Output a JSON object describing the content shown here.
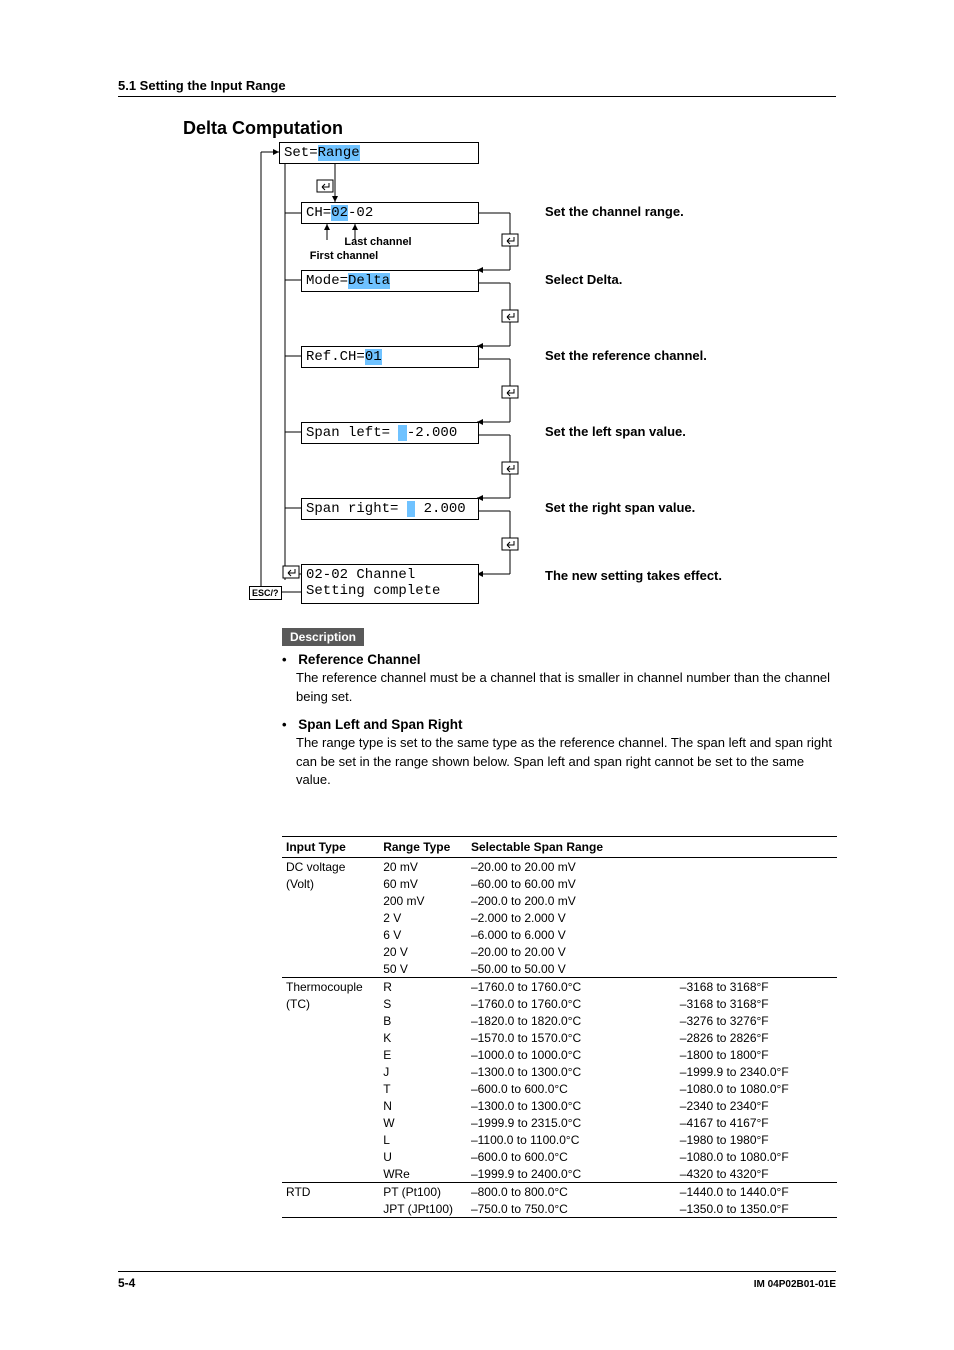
{
  "header": {
    "section": "5.1  Setting the Input Range"
  },
  "title": "Delta Computation",
  "flow": {
    "set": {
      "prefix": "Set=",
      "value": "Range"
    },
    "ch": {
      "prefix": "CH=",
      "v1": "02",
      "dash": "-02"
    },
    "ch_ann": {
      "last": "Last channel",
      "first": "First channel"
    },
    "mode": {
      "prefix": "Mode=",
      "value": "Delta"
    },
    "ref": {
      "prefix": "Ref.CH=",
      "value": "01"
    },
    "spanl": {
      "prefix": "Span left= ",
      "cursor": " ",
      "value": "-2.000"
    },
    "spanr": {
      "prefix": "Span right= ",
      "cursor": " ",
      "value": " 2.000"
    },
    "done": {
      "line1": "02-02 Channel",
      "line2": "Setting complete"
    },
    "esc": "ESC/?",
    "ann": {
      "ch": "Set the channel range.",
      "mode": "Select Delta.",
      "ref": "Set the reference channel.",
      "spanl": "Set the left span value.",
      "spanr": "Set the right span value.",
      "done": "The new setting takes effect."
    }
  },
  "desc": {
    "label": "Description",
    "ref": {
      "head": "Reference Channel",
      "body": "The reference channel must be a channel that is smaller in channel number than the channel being set."
    },
    "span": {
      "head": "Span Left and Span Right",
      "body": "The range type is set to the same type as the reference channel. The span left and span right can be set in the range shown below. Span left and span right cannot be set to the same value."
    }
  },
  "table": {
    "headers": [
      "Input Type",
      "Range Type",
      "Selectable Span Range",
      ""
    ],
    "groups": [
      {
        "input": [
          "DC voltage",
          "(Volt)"
        ],
        "rows": [
          [
            "20 mV",
            "–20.00 to 20.00 mV",
            ""
          ],
          [
            "60 mV",
            "–60.00 to 60.00 mV",
            ""
          ],
          [
            "200 mV",
            "–200.0 to 200.0 mV",
            ""
          ],
          [
            "2 V",
            "–2.000 to 2.000 V",
            ""
          ],
          [
            "6 V",
            "–6.000 to 6.000 V",
            ""
          ],
          [
            "20 V",
            "–20.00 to 20.00 V",
            ""
          ],
          [
            "50 V",
            "–50.00 to 50.00 V",
            ""
          ]
        ]
      },
      {
        "input": [
          "Thermocouple",
          "(TC)"
        ],
        "rows": [
          [
            "R",
            "–1760.0 to 1760.0°C",
            "–3168 to 3168°F"
          ],
          [
            "S",
            "–1760.0 to 1760.0°C",
            "–3168 to 3168°F"
          ],
          [
            "B",
            "–1820.0 to 1820.0°C",
            "–3276 to 3276°F"
          ],
          [
            "K",
            "–1570.0 to 1570.0°C",
            "–2826 to 2826°F"
          ],
          [
            "E",
            "–1000.0 to 1000.0°C",
            "–1800 to 1800°F"
          ],
          [
            "J",
            "–1300.0 to 1300.0°C",
            "–1999.9 to 2340.0°F"
          ],
          [
            "T",
            "–600.0 to 600.0°C",
            "–1080.0 to 1080.0°F"
          ],
          [
            "N",
            "–1300.0 to 1300.0°C",
            "–2340 to 2340°F"
          ],
          [
            "W",
            "–1999.9 to 2315.0°C",
            "–4167 to 4167°F"
          ],
          [
            "L",
            "–1100.0 to 1100.0°C",
            "–1980 to 1980°F"
          ],
          [
            "U",
            "–600.0 to 600.0°C",
            "–1080.0 to 1080.0°F"
          ],
          [
            "WRe",
            "–1999.9 to 2400.0°C",
            "–4320 to 4320°F"
          ]
        ]
      },
      {
        "input": [
          "RTD"
        ],
        "rows": [
          [
            "PT (Pt100)",
            "–800.0 to 800.0°C",
            "–1440.0 to 1440.0°F"
          ],
          [
            "JPT (JPt100)",
            "–750.0 to 750.0°C",
            "–1350.0 to 1350.0°F"
          ]
        ]
      }
    ]
  },
  "footer": {
    "page": "5-4",
    "doc": "IM 04P02B01-01E"
  }
}
